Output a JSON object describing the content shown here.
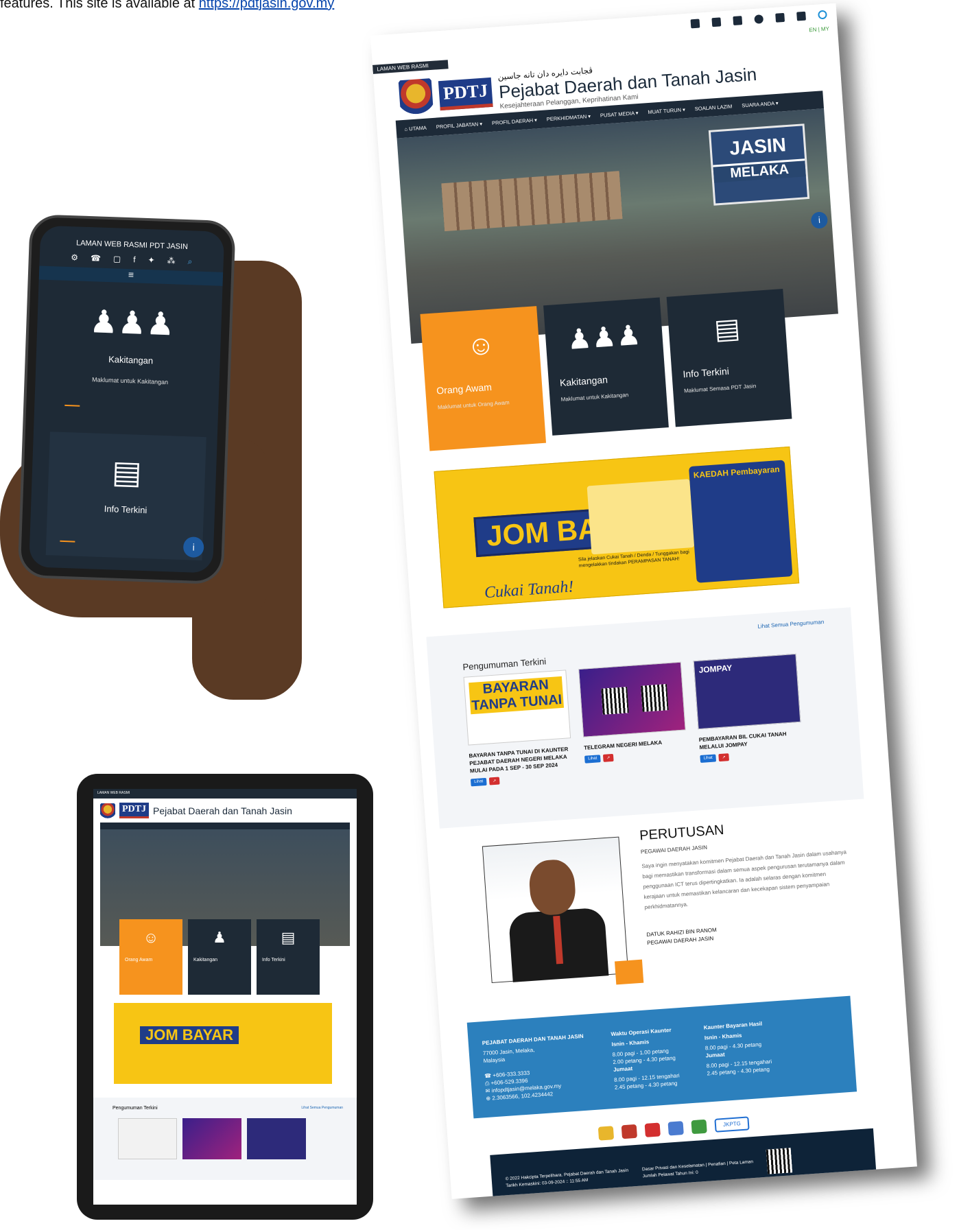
{
  "caption": {
    "text": "features. This site is available at ",
    "link": "https://pdtjasin.gov.my"
  },
  "desktop": {
    "topbar_icons": [
      "gear-icon",
      "phone-icon",
      "chat-icon",
      "facebook-icon",
      "twitter-icon",
      "sitemap-icon",
      "search-icon"
    ],
    "lang": "EN | MY",
    "official": "LAMAN WEB RASMI",
    "jawi": "ڤجابت دايره دان تانه جاسين",
    "pdtj": "PDTJ",
    "title": "Pejabat Daerah dan Tanah Jasin",
    "tagline": "Kesejahteraan Pelanggan, Keprihatinan Kami",
    "nav": [
      "UTAMA",
      "PROFIL JABATAN ▾",
      "PROFIL DAERAH ▾",
      "PERKHIDMATAN ▾",
      "PUSAT MEDIA ▾",
      "MUAT TURUN ▾",
      "SOALAN LAZIM",
      "SUARA ANDA ▾"
    ],
    "hero_sign": {
      "line1": "JASIN",
      "line2": "MELAKA"
    },
    "cards": [
      {
        "title": "Orang Awam",
        "desc": "Maklumat untuk Orang Awam"
      },
      {
        "title": "Kakitangan",
        "desc": "Maklumat untuk Kakitangan"
      },
      {
        "title": "Info Terkini",
        "desc": "Maklumat Semasa PDT Jasin"
      }
    ],
    "banner": {
      "jom": "JOM BAYAR",
      "cukai": "Cukai Tanah!",
      "kaedah": "KAEDAH Pembayaran",
      "note": "Sila jelaskan Cukai Tanah / Denda / Tunggakan bagi mengelakkan tindakan PERAMPASAN TANAH!"
    },
    "announcements": {
      "heading": "Pengumuman Terkini",
      "view_all": "Lihat Semua Pengumuman",
      "items": [
        {
          "title": "BAYARAN TANPA TUNAI DI KAUNTER PEJABAT DAERAH NEGERI MELAKA MULAI PADA 1 SEP - 30 SEP 2024",
          "thumb_text": "BAYARAN TANPA TUNAI"
        },
        {
          "title": "TELEGRAM NEGERI MELAKA",
          "thumb_text": ""
        },
        {
          "title": "PEMBAYARAN BIL CUKAI TANAH MELALUI JOMPAY",
          "thumb_text": "JOMPAY"
        }
      ],
      "btn_view": "Lihat"
    },
    "message": {
      "title": "PERUTUSAN",
      "subtitle": "PEGAWAI DAERAH JASIN",
      "body": "Saya ingin menyatakan komitmen Pejabat Daerah dan Tanah Jasin dalam usahanya bagi memastikan transformasi dalam semua aspek pengurusan terutamanya dalam penggunaan ICT terus dipertingkatkan. Ia adalah selaras dengan komitmen kerajaan untuk memastikan kelancaran dan kecekapan sistem penyampaian perkhidmatannya.",
      "name": "DATUK RAHIZI BIN RANOM",
      "role": "PEGAWAI DAERAH JASIN"
    },
    "footer": {
      "office": "PEJABAT DAERAH DAN TANAH JASIN",
      "address1": "77000 Jasin, Melaka,",
      "address2": "Malaysia",
      "phone": "+606-333.3333",
      "fax": "+606-529.3396",
      "email": "infopdtjasin@melaka.gov.my",
      "coords": "2.3063566, 102.4234442",
      "hours_title": "Waktu Operasi Kaunter",
      "hours_days1": "Isnin - Khamis",
      "hours_a": "8.00 pagi - 1.00 petang",
      "hours_b": "2.00 petang - 4.30 petang",
      "hours_days2": "Jumaat",
      "hours_c": "8.00 pagi - 12.15 tengahari",
      "hours_d": "2.45 petang - 4.30 petang",
      "pay_title": "Kaunter Bayaran Hasil",
      "pay_days1": "Isnin - Khamis",
      "pay_a": "8.00 pagi - 4.30 petang",
      "pay_days2": "Jumaat",
      "pay_b": "8.00 pagi - 12.15 tengahari",
      "pay_c": "2.45 petang - 4.30 petang"
    },
    "logos": [
      "JKPTG"
    ],
    "copyright": "© 2022 Hakcipta Terpelihara. Pejabat Daerah dan Tanah Jasin",
    "updated": "Tarikh Kemaskini: 03-09-2024 :: 11:55 AM",
    "policy": "Dasar Privasi dan Keselamatan | Penafian | Peta Laman",
    "visitors": "Jumlah Pelawat Tahun Ini: 0"
  },
  "phone": {
    "official": "LAMAN WEB RASMI PDT JASIN",
    "cards": [
      {
        "title": "Kakitangan",
        "desc": "Maklumat untuk Kakitangan"
      },
      {
        "title": "Info Terkini",
        "desc": ""
      }
    ],
    "info": "i"
  },
  "tablet": {
    "official": "LAMAN WEB RASMI",
    "title": "Pejabat Daerah dan Tanah Jasin",
    "cards": [
      "Orang Awam",
      "Kakitangan",
      "Info Terkini"
    ],
    "jom": "JOM BAYAR",
    "ann_heading": "Pengumuman Terkini",
    "ann_all": "Lihat Semua Pengumuman"
  }
}
